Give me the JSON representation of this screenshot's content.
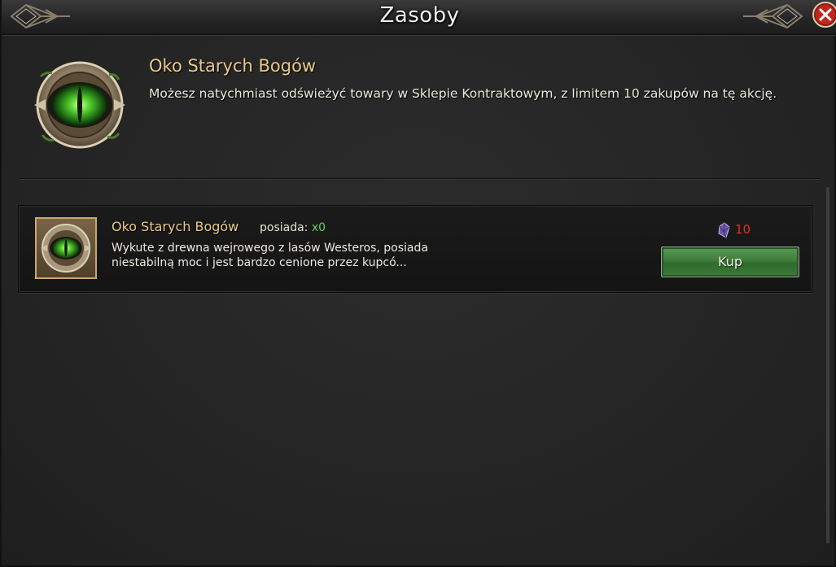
{
  "window": {
    "title": "Zasoby",
    "close_icon": "close-icon"
  },
  "header": {
    "icon": "weirwood-eye-icon",
    "title": "Oko Starych Bogów",
    "description": "Możesz natychmiast odświeżyć towary w Sklepie Kontraktowym, z limitem 10 zakupów na tę akcję."
  },
  "items": [
    {
      "icon": "weirwood-eye-icon",
      "name": "Oko Starych Bogów",
      "owned_label": "posiada:",
      "owned_count": "x0",
      "description_line1": "Wykute z drewna wejrowego z lasów Westeros, posiada",
      "description_line2": "niestabilną moc i jest bardzo cenione przez kupcó...",
      "price_icon": "purple-gem-icon",
      "price": "10",
      "buy_label": "Kup"
    }
  ],
  "colors": {
    "accent_gold": "#e9c98b",
    "price_red": "#e0302a",
    "owned_green": "#5ed35a",
    "button_green": "#3f7d3a",
    "close_red": "#c0271f"
  }
}
